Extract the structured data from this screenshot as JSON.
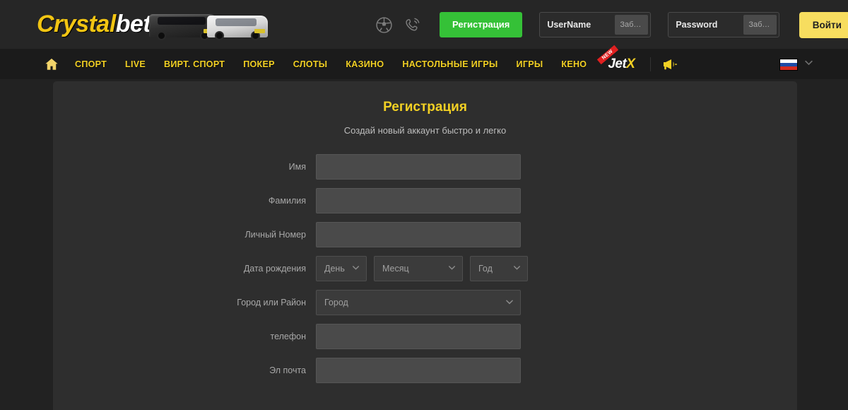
{
  "brand": {
    "logo_part1": "Crystal",
    "logo_part2": "bet",
    "accent_yellow": "#f2d024",
    "accent_green": "#35c137",
    "login_button_color": "#f7dd5f"
  },
  "header": {
    "icons": [
      {
        "name": "soccer-ball-icon"
      },
      {
        "name": "phone-call-icon"
      }
    ],
    "register_label": "Регистрация",
    "username": {
      "label": "UserName",
      "value": "",
      "forgot_label": "Забыли"
    },
    "password": {
      "label": "Password",
      "value": "",
      "forgot_label": "Забыли"
    },
    "login_label": "Войти"
  },
  "nav": {
    "home_icon": "home-icon",
    "items": [
      {
        "label": "СПОРТ"
      },
      {
        "label": "LIVE"
      },
      {
        "label": "ВИРТ. СПОРТ"
      },
      {
        "label": "ПОКЕР"
      },
      {
        "label": "СЛОТЫ"
      },
      {
        "label": "КАЗИНО"
      },
      {
        "label": "НАСТОЛЬНЫЕ ИГРЫ"
      },
      {
        "label": "ИГРЫ"
      },
      {
        "label": "КЕНО"
      }
    ],
    "jetx": {
      "part1": "Jet",
      "part2": "X",
      "badge": "NEW"
    },
    "promo_icon": "megaphone-icon",
    "language": {
      "flag": "flag-ru-icon",
      "chevron": "chevron-down-icon"
    }
  },
  "registration": {
    "title": "Регистрация",
    "subtitle": "Создай новый аккаунт быстро и легко",
    "fields": [
      {
        "label": "Имя",
        "value": "",
        "type": "text"
      },
      {
        "label": "Фамилия",
        "value": "",
        "type": "text"
      },
      {
        "label": "Личный Номер",
        "value": "",
        "type": "text"
      },
      {
        "label": "телефон",
        "value": "",
        "type": "text"
      },
      {
        "label": "Эл почта",
        "value": "",
        "type": "text"
      }
    ],
    "birthdate": {
      "label": "Дата рождения",
      "day_placeholder": "День",
      "month_placeholder": "Месяц",
      "year_placeholder": "Год"
    },
    "city": {
      "label": "Город или Район",
      "placeholder": "Город"
    }
  }
}
